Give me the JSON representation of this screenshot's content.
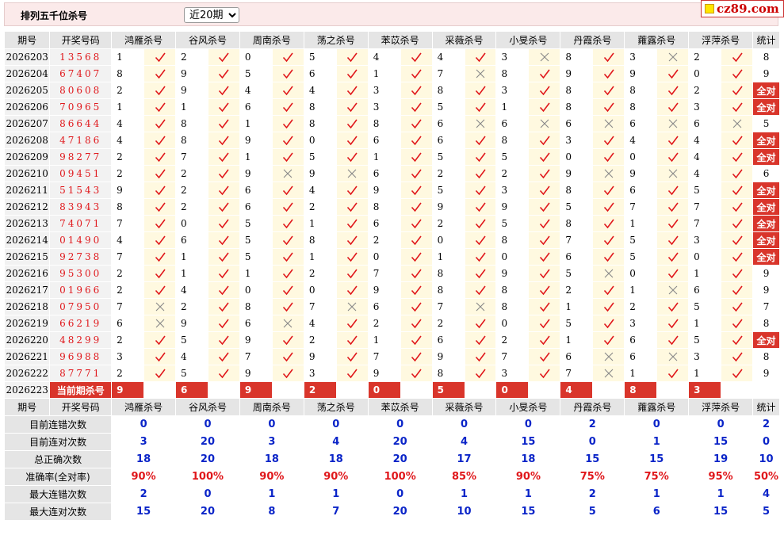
{
  "header": {
    "title": "排列五千位杀号",
    "select_value": "近20期",
    "logo_text": "cz89.com"
  },
  "columns": {
    "period": "期号",
    "number": "开奖号码",
    "experts": [
      "鸿雁杀号",
      "谷风杀号",
      "周南杀号",
      "荡之杀号",
      "苯苡杀号",
      "采薇杀号",
      "小旻杀号",
      "丹霞杀号",
      "蕹露杀号",
      "浮萍杀号"
    ],
    "stat": "统计"
  },
  "rows": [
    {
      "period": "2026203",
      "number": "13568",
      "kills": [
        1,
        2,
        0,
        5,
        4,
        4,
        3,
        8,
        3,
        2
      ],
      "hits": [
        1,
        1,
        1,
        1,
        1,
        1,
        0,
        1,
        0,
        1
      ],
      "stat": "8"
    },
    {
      "period": "2026204",
      "number": "67407",
      "kills": [
        8,
        9,
        5,
        6,
        1,
        7,
        8,
        9,
        9,
        0
      ],
      "hits": [
        1,
        1,
        1,
        1,
        1,
        0,
        1,
        1,
        1,
        1
      ],
      "stat": "9"
    },
    {
      "period": "2026205",
      "number": "80608",
      "kills": [
        2,
        9,
        4,
        4,
        3,
        8,
        3,
        8,
        8,
        2
      ],
      "hits": [
        1,
        1,
        1,
        1,
        1,
        1,
        1,
        1,
        1,
        1
      ],
      "stat": "全对"
    },
    {
      "period": "2026206",
      "number": "70965",
      "kills": [
        1,
        1,
        6,
        8,
        3,
        5,
        1,
        8,
        8,
        3
      ],
      "hits": [
        1,
        1,
        1,
        1,
        1,
        1,
        1,
        1,
        1,
        1
      ],
      "stat": "全对"
    },
    {
      "period": "2026207",
      "number": "86644",
      "kills": [
        4,
        8,
        1,
        8,
        8,
        6,
        6,
        6,
        6,
        6
      ],
      "hits": [
        1,
        1,
        1,
        1,
        1,
        0,
        0,
        0,
        0,
        0
      ],
      "stat": "5"
    },
    {
      "period": "2026208",
      "number": "47186",
      "kills": [
        4,
        8,
        9,
        0,
        6,
        6,
        8,
        3,
        4,
        4
      ],
      "hits": [
        1,
        1,
        1,
        1,
        1,
        1,
        1,
        1,
        1,
        1
      ],
      "stat": "全对"
    },
    {
      "period": "2026209",
      "number": "98277",
      "kills": [
        2,
        7,
        1,
        5,
        1,
        5,
        5,
        0,
        0,
        4
      ],
      "hits": [
        1,
        1,
        1,
        1,
        1,
        1,
        1,
        1,
        1,
        1
      ],
      "stat": "全对"
    },
    {
      "period": "2026210",
      "number": "09451",
      "kills": [
        2,
        2,
        9,
        9,
        6,
        2,
        2,
        9,
        9,
        4
      ],
      "hits": [
        1,
        1,
        0,
        0,
        1,
        1,
        1,
        0,
        0,
        1
      ],
      "stat": "6"
    },
    {
      "period": "2026211",
      "number": "51543",
      "kills": [
        9,
        2,
        6,
        4,
        9,
        5,
        3,
        8,
        6,
        5
      ],
      "hits": [
        1,
        1,
        1,
        1,
        1,
        1,
        1,
        1,
        1,
        1
      ],
      "stat": "全对"
    },
    {
      "period": "2026212",
      "number": "83943",
      "kills": [
        8,
        2,
        6,
        2,
        8,
        9,
        9,
        5,
        7,
        7
      ],
      "hits": [
        1,
        1,
        1,
        1,
        1,
        1,
        1,
        1,
        1,
        1
      ],
      "stat": "全对"
    },
    {
      "period": "2026213",
      "number": "74071",
      "kills": [
        7,
        0,
        5,
        1,
        6,
        2,
        5,
        8,
        1,
        7
      ],
      "hits": [
        1,
        1,
        1,
        1,
        1,
        1,
        1,
        1,
        1,
        1
      ],
      "stat": "全对"
    },
    {
      "period": "2026214",
      "number": "01490",
      "kills": [
        4,
        6,
        5,
        8,
        2,
        0,
        8,
        7,
        5,
        3
      ],
      "hits": [
        1,
        1,
        1,
        1,
        1,
        1,
        1,
        1,
        1,
        1
      ],
      "stat": "全对"
    },
    {
      "period": "2026215",
      "number": "92738",
      "kills": [
        7,
        1,
        5,
        1,
        0,
        1,
        0,
        6,
        5,
        0
      ],
      "hits": [
        1,
        1,
        1,
        1,
        1,
        1,
        1,
        1,
        1,
        1
      ],
      "stat": "全对"
    },
    {
      "period": "2026216",
      "number": "95300",
      "kills": [
        2,
        1,
        1,
        2,
        7,
        8,
        9,
        5,
        0,
        1
      ],
      "hits": [
        1,
        1,
        1,
        1,
        1,
        1,
        1,
        0,
        1,
        1
      ],
      "stat": "9"
    },
    {
      "period": "2026217",
      "number": "01966",
      "kills": [
        2,
        4,
        0,
        0,
        9,
        8,
        8,
        2,
        1,
        6
      ],
      "hits": [
        1,
        1,
        1,
        1,
        1,
        1,
        1,
        1,
        0,
        1
      ],
      "stat": "9"
    },
    {
      "period": "2026218",
      "number": "07950",
      "kills": [
        7,
        2,
        8,
        7,
        6,
        7,
        8,
        1,
        2,
        5
      ],
      "hits": [
        0,
        1,
        1,
        0,
        1,
        0,
        1,
        1,
        1,
        1
      ],
      "stat": "7"
    },
    {
      "period": "2026219",
      "number": "66219",
      "kills": [
        6,
        9,
        6,
        4,
        2,
        2,
        0,
        5,
        3,
        1
      ],
      "hits": [
        0,
        1,
        0,
        1,
        1,
        1,
        1,
        1,
        1,
        1
      ],
      "stat": "8"
    },
    {
      "period": "2026220",
      "number": "48299",
      "kills": [
        2,
        5,
        9,
        2,
        1,
        6,
        2,
        1,
        6,
        5
      ],
      "hits": [
        1,
        1,
        1,
        1,
        1,
        1,
        1,
        1,
        1,
        1
      ],
      "stat": "全对"
    },
    {
      "period": "2026221",
      "number": "96988",
      "kills": [
        3,
        4,
        7,
        9,
        7,
        9,
        7,
        6,
        6,
        3
      ],
      "hits": [
        1,
        1,
        1,
        1,
        1,
        1,
        1,
        0,
        0,
        1
      ],
      "stat": "8"
    },
    {
      "period": "2026222",
      "number": "87771",
      "kills": [
        2,
        5,
        9,
        3,
        9,
        8,
        3,
        7,
        1,
        1
      ],
      "hits": [
        1,
        1,
        1,
        1,
        1,
        1,
        1,
        0,
        1,
        1
      ],
      "stat": "9"
    }
  ],
  "current": {
    "period": "2026223",
    "label": "当前期杀号",
    "values": [
      "9",
      "6",
      "9",
      "2",
      "0",
      "5",
      "0",
      "4",
      "8",
      "3"
    ]
  },
  "summary": [
    {
      "label": "目前连错次数",
      "values": [
        "0",
        "0",
        "0",
        "0",
        "0",
        "0",
        "0",
        "2",
        "0",
        "0",
        "2"
      ]
    },
    {
      "label": "目前连对次数",
      "values": [
        "3",
        "20",
        "3",
        "4",
        "20",
        "4",
        "15",
        "0",
        "1",
        "15",
        "0"
      ]
    },
    {
      "label": "总正确次数",
      "values": [
        "18",
        "20",
        "18",
        "18",
        "20",
        "17",
        "18",
        "15",
        "15",
        "19",
        "10"
      ]
    },
    {
      "label": "准确率(全对率)",
      "values": [
        "90%",
        "100%",
        "90%",
        "90%",
        "100%",
        "85%",
        "90%",
        "75%",
        "75%",
        "95%",
        "50%"
      ],
      "red": true
    },
    {
      "label": "最大连错次数",
      "values": [
        "2",
        "0",
        "1",
        "1",
        "0",
        "1",
        "1",
        "2",
        "1",
        "1",
        "4"
      ]
    },
    {
      "label": "最大连对次数",
      "values": [
        "15",
        "20",
        "8",
        "7",
        "20",
        "10",
        "15",
        "5",
        "6",
        "15",
        "5"
      ]
    }
  ],
  "colors": {
    "accent_red": "#d9352b",
    "number_red": "#e0171b",
    "summary_blue": "#0a24c8",
    "mark_bg": "#fff9e0"
  }
}
